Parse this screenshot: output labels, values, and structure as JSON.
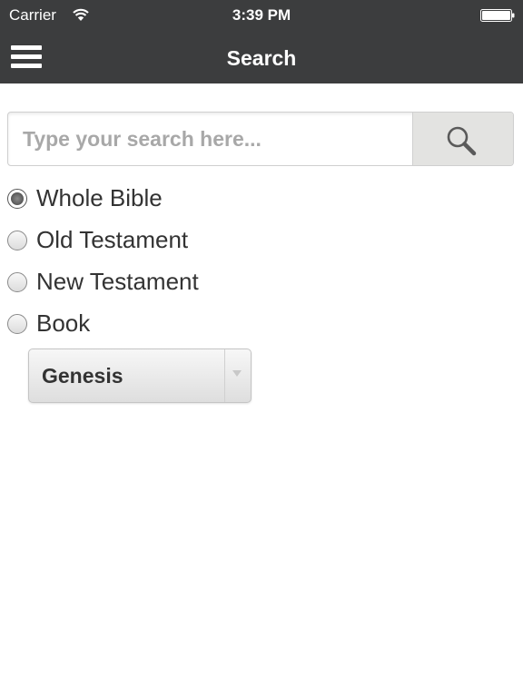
{
  "status_bar": {
    "carrier": "Carrier",
    "time": "3:39 PM",
    "icons": [
      "wifi-icon",
      "battery-icon"
    ]
  },
  "nav_bar": {
    "title": "Search",
    "menu_icon": "menu-icon",
    "background": "#3c3d3e"
  },
  "search": {
    "placeholder": "Type your search here...",
    "value": "",
    "button_icon": "search-icon"
  },
  "scope": {
    "options": [
      {
        "label": "Whole Bible",
        "checked": true
      },
      {
        "label": "Old Testament",
        "checked": false
      },
      {
        "label": "New Testament",
        "checked": false
      },
      {
        "label": "Book",
        "checked": false
      }
    ]
  },
  "book_select": {
    "value": "Genesis",
    "icon": "chevron-down-icon"
  }
}
